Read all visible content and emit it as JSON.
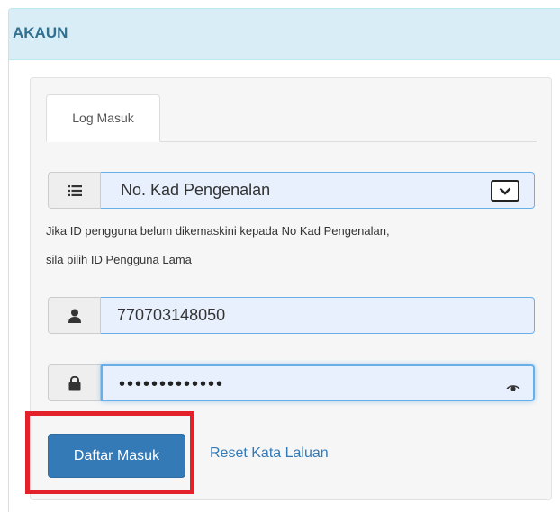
{
  "panel": {
    "title": "AKAUN"
  },
  "tabs": [
    {
      "label": "Log Masuk",
      "active": true
    }
  ],
  "id_type": {
    "selected": "No. Kad Pengenalan",
    "icon": "list-icon"
  },
  "help_text": {
    "line1": "Jika ID pengguna belum dikemaskini kepada No Kad Pengenalan,",
    "line2": "sila pilih ID Pengguna Lama"
  },
  "username": {
    "value": "770703148050",
    "icon": "user-icon"
  },
  "password": {
    "masked_value": "•••••••••••••",
    "icon": "lock-icon",
    "toggle_icon": "eye-icon"
  },
  "actions": {
    "login_label": "Daftar Masuk",
    "reset_label": "Reset Kata Laluan"
  },
  "colors": {
    "primary": "#337ab7",
    "heading_bg": "#d9edf7",
    "heading_text": "#31708f",
    "highlight": "#e3212b",
    "input_bg": "#e8f0fe"
  }
}
